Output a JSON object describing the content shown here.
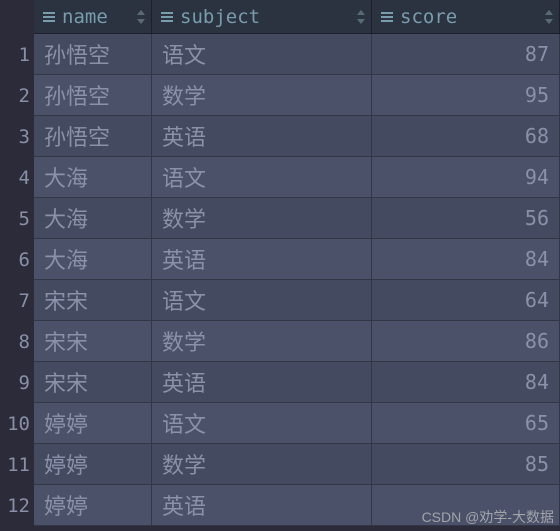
{
  "columns": [
    {
      "key": "name",
      "label": "name",
      "numeric": false
    },
    {
      "key": "subject",
      "label": "subject",
      "numeric": false
    },
    {
      "key": "score",
      "label": "score",
      "numeric": true
    }
  ],
  "rows": [
    {
      "n": "1",
      "name": "孙悟空",
      "subject": "语文",
      "score": "87"
    },
    {
      "n": "2",
      "name": "孙悟空",
      "subject": "数学",
      "score": "95"
    },
    {
      "n": "3",
      "name": "孙悟空",
      "subject": "英语",
      "score": "68"
    },
    {
      "n": "4",
      "name": "大海",
      "subject": "语文",
      "score": "94"
    },
    {
      "n": "5",
      "name": "大海",
      "subject": "数学",
      "score": "56"
    },
    {
      "n": "6",
      "name": "大海",
      "subject": "英语",
      "score": "84"
    },
    {
      "n": "7",
      "name": "宋宋",
      "subject": "语文",
      "score": "64"
    },
    {
      "n": "8",
      "name": "宋宋",
      "subject": "数学",
      "score": "86"
    },
    {
      "n": "9",
      "name": "宋宋",
      "subject": "英语",
      "score": "84"
    },
    {
      "n": "10",
      "name": "婷婷",
      "subject": "语文",
      "score": "65"
    },
    {
      "n": "11",
      "name": "婷婷",
      "subject": "数学",
      "score": "85"
    },
    {
      "n": "12",
      "name": "婷婷",
      "subject": "英语",
      "score": ""
    }
  ],
  "watermark": "CSDN @劝学-大数据",
  "chart_data": {
    "type": "table",
    "columns": [
      "name",
      "subject",
      "score"
    ],
    "rows": [
      [
        "孙悟空",
        "语文",
        87
      ],
      [
        "孙悟空",
        "数学",
        95
      ],
      [
        "孙悟空",
        "英语",
        68
      ],
      [
        "大海",
        "语文",
        94
      ],
      [
        "大海",
        "数学",
        56
      ],
      [
        "大海",
        "英语",
        84
      ],
      [
        "宋宋",
        "语文",
        64
      ],
      [
        "宋宋",
        "数学",
        86
      ],
      [
        "宋宋",
        "英语",
        84
      ],
      [
        "婷婷",
        "语文",
        65
      ],
      [
        "婷婷",
        "数学",
        85
      ],
      [
        "婷婷",
        "英语",
        null
      ]
    ]
  }
}
